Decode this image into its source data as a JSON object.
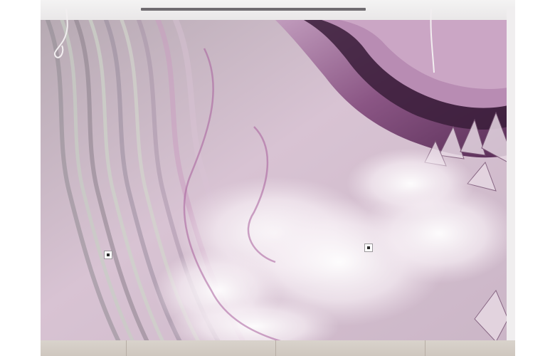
{
  "scene": {
    "subject": "",
    "colors": {
      "amethyst_dark": "#3a1d3a",
      "amethyst": "#7a4a77",
      "lilac": "#c9a8c4",
      "pale_pink": "#e9d8e6",
      "cloud_white": "#f7f3f6",
      "sage_grey": "#b9bdb3",
      "ceiling": "#efedee",
      "floor": "#d4ccc4"
    }
  }
}
